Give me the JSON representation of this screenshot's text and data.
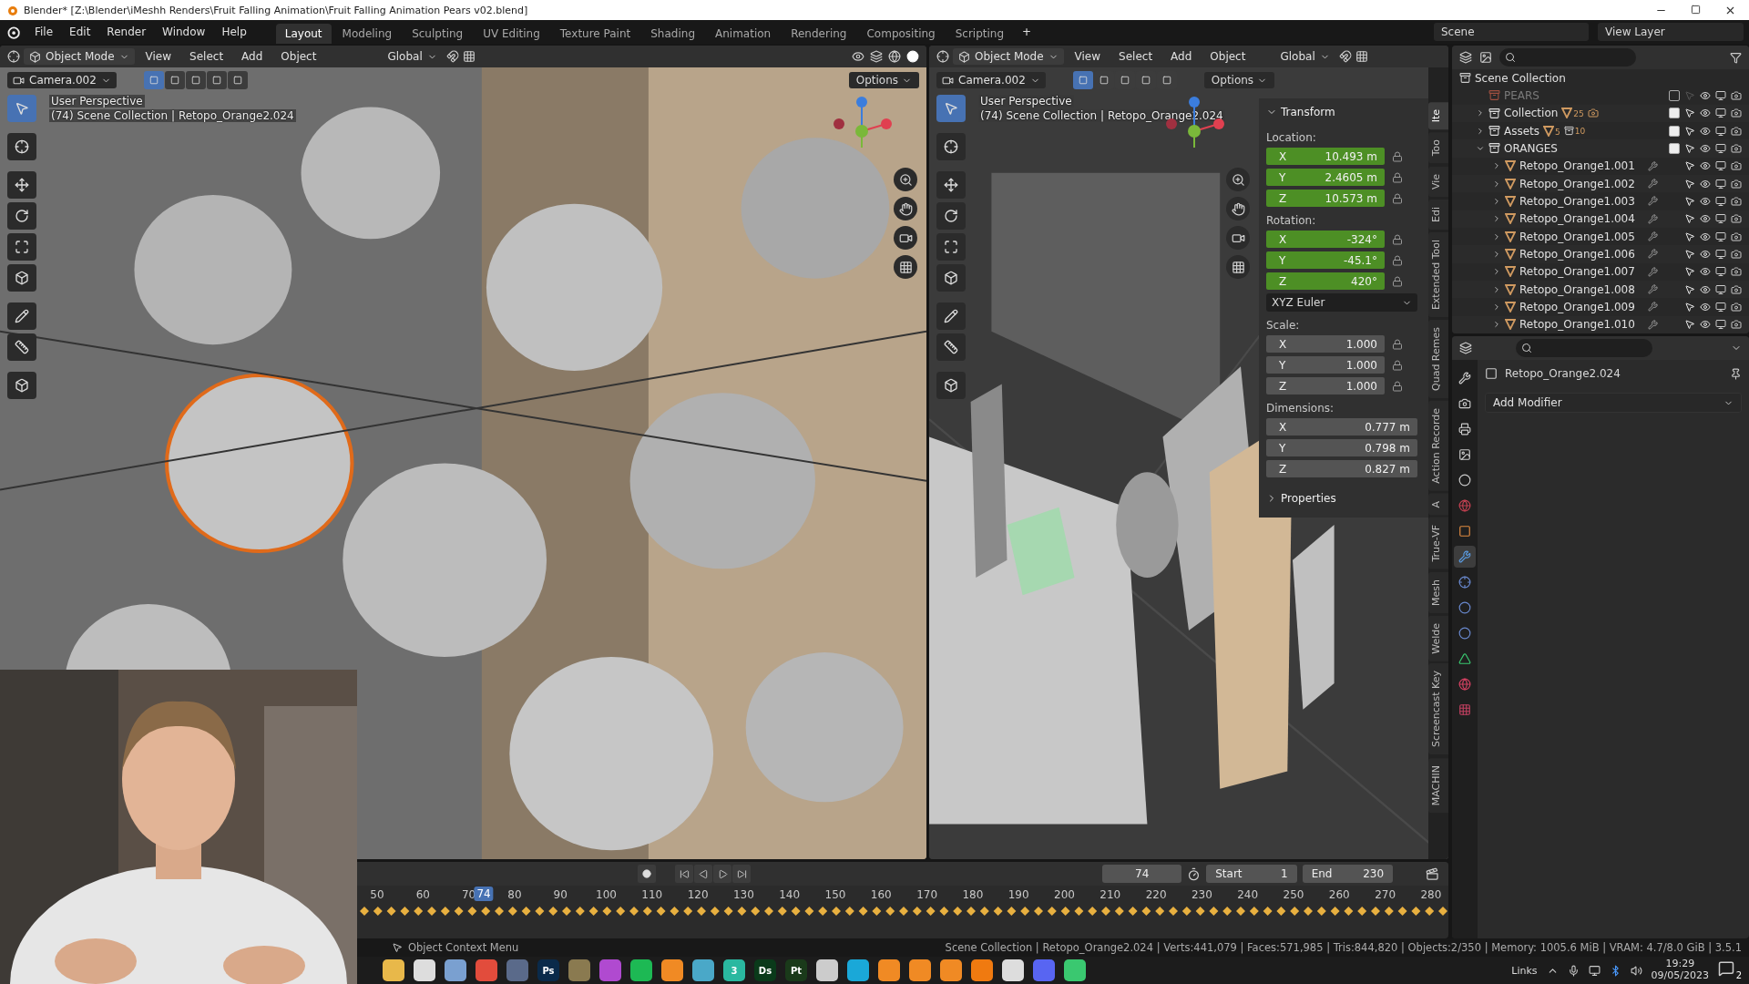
{
  "title_bar": {
    "title": "Blender* [Z:\\Blender\\iMeshh Renders\\Fruit Falling Animation\\Fruit Falling Animation Pears v02.blend]"
  },
  "menu": [
    "File",
    "Edit",
    "Render",
    "Window",
    "Help"
  ],
  "workspaces": [
    {
      "label": "Layout",
      "selected": true
    },
    {
      "label": "Modeling",
      "selected": false
    },
    {
      "label": "Sculpting",
      "selected": false
    },
    {
      "label": "UV Editing",
      "selected": false
    },
    {
      "label": "Texture Paint",
      "selected": false
    },
    {
      "label": "Shading",
      "selected": false
    },
    {
      "label": "Animation",
      "selected": false
    },
    {
      "label": "Rendering",
      "selected": false
    },
    {
      "label": "Compositing",
      "selected": false
    },
    {
      "label": "Scripting",
      "selected": false
    }
  ],
  "add_workspace": "+",
  "scene": "Scene",
  "view_layer": "View Layer",
  "viewports": [
    {
      "mode": "Object Mode",
      "menus": [
        "View",
        "Select",
        "Add",
        "Object"
      ],
      "orientation": "Global",
      "camera": "Camera.002",
      "options": "Options",
      "perspective": "User Perspective",
      "context": "(74) Scene Collection | Retopo_Orange2.024"
    },
    {
      "mode": "Object Mode",
      "menus": [
        "View",
        "Select",
        "Add",
        "Object"
      ],
      "orientation": "Global",
      "camera": "Camera.002",
      "options": "Options",
      "perspective": "User Perspective",
      "context": "(74) Scene Collection | Retopo_Orange2.024"
    }
  ],
  "n_panel": {
    "title": "Transform",
    "groups": [
      {
        "label": "Location:",
        "fields": [
          {
            "axis": "X",
            "value": "10.493 m",
            "keyframed": true
          },
          {
            "axis": "Y",
            "value": "2.4605 m",
            "keyframed": true
          },
          {
            "axis": "Z",
            "value": "10.573 m",
            "keyframed": true
          }
        ]
      },
      {
        "label": "Rotation:",
        "fields": [
          {
            "axis": "X",
            "value": "-324°",
            "keyframed": true
          },
          {
            "axis": "Y",
            "value": "-45.1°",
            "keyframed": true
          },
          {
            "axis": "Z",
            "value": "420°",
            "keyframed": true
          }
        ],
        "mode": "XYZ Euler"
      },
      {
        "label": "Scale:",
        "fields": [
          {
            "axis": "X",
            "value": "1.000",
            "keyframed": false
          },
          {
            "axis": "Y",
            "value": "1.000",
            "keyframed": false
          },
          {
            "axis": "Z",
            "value": "1.000",
            "keyframed": false
          }
        ]
      },
      {
        "label": "Dimensions:",
        "fields": [
          {
            "axis": "X",
            "value": "0.777 m",
            "keyframed": false
          },
          {
            "axis": "Y",
            "value": "0.798 m",
            "keyframed": false
          },
          {
            "axis": "Z",
            "value": "0.827 m",
            "keyframed": false
          }
        ]
      }
    ],
    "properties": "Properties"
  },
  "side_tabs": [
    {
      "label": "Ite",
      "selected": true
    },
    {
      "label": "Too",
      "selected": false
    },
    {
      "label": "Vie",
      "selected": false
    },
    {
      "label": "Edi",
      "selected": false
    },
    {
      "label": "Extended Tool",
      "selected": false
    },
    {
      "label": "Quad Remes",
      "selected": false
    },
    {
      "label": "Action Recorde",
      "selected": false
    },
    {
      "label": "A",
      "selected": false
    },
    {
      "label": "True-VF",
      "selected": false
    },
    {
      "label": "Mesh",
      "selected": false
    },
    {
      "label": "Welde",
      "selected": false
    },
    {
      "label": "Screencast Key",
      "selected": false
    },
    {
      "label": "MACHIN",
      "selected": false
    }
  ],
  "outliner": {
    "root": "Scene Collection",
    "items": [
      {
        "kind": "collection",
        "name": "PEARS",
        "checked": false,
        "disabled": true
      },
      {
        "kind": "collection",
        "name": "Collection",
        "checked": true,
        "disabled": false,
        "expanded": false,
        "badges": [
          {
            "kind": "mesh",
            "count": "25"
          },
          {
            "kind": "camera"
          }
        ]
      },
      {
        "kind": "collection",
        "name": "Assets",
        "checked": true,
        "disabled": false,
        "expanded": false,
        "badges": [
          {
            "kind": "mesh",
            "count": "5"
          },
          {
            "kind": "collection",
            "count": "10"
          }
        ]
      },
      {
        "kind": "collection",
        "name": "ORANGES",
        "checked": true,
        "disabled": false,
        "expanded": true,
        "children": [
          {
            "kind": "mesh",
            "name": "Retopo_Orange1.001",
            "expanded": false
          },
          {
            "kind": "mesh",
            "name": "Retopo_Orange1.002",
            "expanded": false
          },
          {
            "kind": "mesh",
            "name": "Retopo_Orange1.003",
            "expanded": false
          },
          {
            "kind": "mesh",
            "name": "Retopo_Orange1.004",
            "expanded": false
          },
          {
            "kind": "mesh",
            "name": "Retopo_Orange1.005",
            "expanded": false
          },
          {
            "kind": "mesh",
            "name": "Retopo_Orange1.006",
            "expanded": false
          },
          {
            "kind": "mesh",
            "name": "Retopo_Orange1.007",
            "expanded": false
          },
          {
            "kind": "mesh",
            "name": "Retopo_Orange1.008",
            "expanded": false
          },
          {
            "kind": "mesh",
            "name": "Retopo_Orange1.009",
            "expanded": false
          },
          {
            "kind": "mesh",
            "name": "Retopo_Orange1.010",
            "expanded": false
          }
        ]
      }
    ]
  },
  "properties": {
    "object": "Retopo_Orange2.024",
    "add_modifier": "Add Modifier",
    "tabs": [
      {
        "kind": "tool",
        "selected": false
      },
      {
        "kind": "render",
        "selected": false
      },
      {
        "kind": "output",
        "selected": false
      },
      {
        "kind": "view_layer",
        "selected": false
      },
      {
        "kind": "scene",
        "selected": false
      },
      {
        "kind": "world",
        "selected": false
      },
      {
        "kind": "object",
        "selected": false
      },
      {
        "kind": "modifiers",
        "selected": true
      },
      {
        "kind": "particles",
        "selected": false
      },
      {
        "kind": "physics",
        "selected": false
      },
      {
        "kind": "constraints",
        "selected": false
      },
      {
        "kind": "data",
        "selected": false
      },
      {
        "kind": "material",
        "selected": false
      },
      {
        "kind": "texture",
        "selected": false
      }
    ]
  },
  "timeline": {
    "frame": "74",
    "start_label": "Start",
    "start": "1",
    "end_label": "End",
    "end": "230",
    "ticks": [
      "50",
      "60",
      "70",
      "80",
      "90",
      "100",
      "110",
      "120",
      "130",
      "140",
      "150",
      "160",
      "170",
      "180",
      "190",
      "200",
      "210",
      "220",
      "230",
      "240",
      "250",
      "260",
      "270",
      "280"
    ],
    "playhead": {
      "label": "74",
      "level": 0.334
    }
  },
  "status_bar": {
    "hint": "Object Context Menu",
    "stats": "Scene Collection | Retopo_Orange2.024 | Verts:441,079 | Faces:571,985 | Tris:844,820 | Objects:2/350 | Memory: 1005.6 MiB | VRAM: 4.7/8.0 GiB | 3.5.1"
  },
  "taskbar": {
    "apps": [
      {
        "color": "#e8b84a"
      },
      {
        "color": "#dddddd"
      },
      {
        "color": "#7aa0d0"
      },
      {
        "color": "#e24c3c"
      },
      {
        "color": "#5a6a8a"
      },
      {
        "color": "#0a2a4a",
        "label": "Ps"
      },
      {
        "color": "#8a7a50"
      },
      {
        "color": "#b04ad0"
      },
      {
        "color": "#1db954"
      },
      {
        "color": "#f08a24"
      },
      {
        "color": "#4aa8c8"
      },
      {
        "color": "#2ab8a0",
        "label": "3"
      },
      {
        "color": "#0a3a1a",
        "label": "Ds"
      },
      {
        "color": "#1a3a1a",
        "label": "Pt"
      },
      {
        "color": "#cccccc"
      },
      {
        "color": "#1aa8d8"
      },
      {
        "color": "#f08a24"
      },
      {
        "color": "#f08a24"
      },
      {
        "color": "#f08a24"
      },
      {
        "color": "#f07a10"
      },
      {
        "color": "#dddddd"
      },
      {
        "color": "#5865f2"
      },
      {
        "color": "#3ac870"
      }
    ],
    "tray_label": "Links",
    "time": "19:29",
    "date": "09/05/2023",
    "notifications": "2"
  }
}
